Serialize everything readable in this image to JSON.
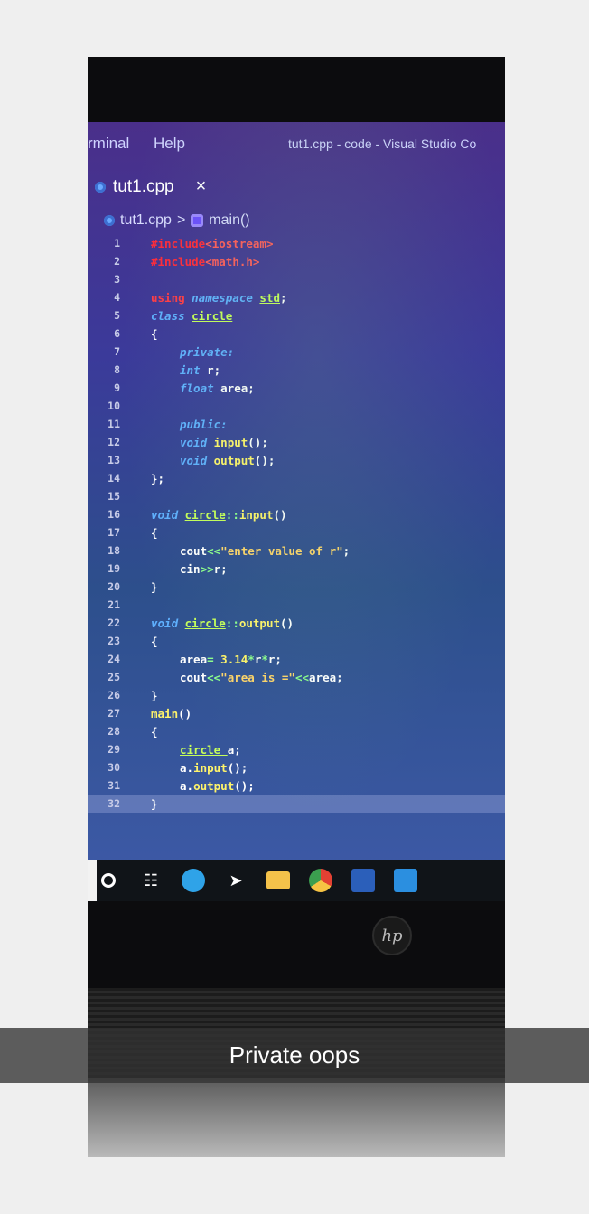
{
  "photo": {
    "menu": {
      "item_terminal": "rminal",
      "item_help": "Help",
      "window_title": "tut1.cpp - code - Visual Studio Co"
    },
    "tab": {
      "filename": "tut1.cpp",
      "close_glyph": "×"
    },
    "breadcrumb": {
      "file": "tut1.cpp",
      "separator": ">",
      "symbol": "main()"
    },
    "code_lines": [
      {
        "n": "1",
        "indent": 0,
        "parts": [
          {
            "t": "#include",
            "c": "inc"
          },
          {
            "t": "<iostream>",
            "c": "incf"
          }
        ]
      },
      {
        "n": "2",
        "indent": 0,
        "parts": [
          {
            "t": "#include",
            "c": "inc"
          },
          {
            "t": "<math.h>",
            "c": "incf"
          }
        ]
      },
      {
        "n": "3",
        "indent": 0,
        "parts": []
      },
      {
        "n": "4",
        "indent": 0,
        "parts": [
          {
            "t": "using ",
            "c": "kw"
          },
          {
            "t": "namespace ",
            "c": "ty"
          },
          {
            "t": "std",
            "c": "cls"
          },
          {
            "t": ";",
            "c": ""
          }
        ]
      },
      {
        "n": "5",
        "indent": 0,
        "parts": [
          {
            "t": "class ",
            "c": "ty"
          },
          {
            "t": "circle",
            "c": "cls"
          }
        ]
      },
      {
        "n": "6",
        "indent": 0,
        "parts": [
          {
            "t": "{",
            "c": ""
          }
        ]
      },
      {
        "n": "7",
        "indent": 1,
        "parts": [
          {
            "t": "private:",
            "c": "ty"
          }
        ]
      },
      {
        "n": "8",
        "indent": 1,
        "parts": [
          {
            "t": "int ",
            "c": "ty"
          },
          {
            "t": "r;",
            "c": ""
          }
        ]
      },
      {
        "n": "9",
        "indent": 1,
        "parts": [
          {
            "t": "float ",
            "c": "ty"
          },
          {
            "t": "area;",
            "c": ""
          }
        ]
      },
      {
        "n": "10",
        "indent": 0,
        "parts": []
      },
      {
        "n": "11",
        "indent": 1,
        "parts": [
          {
            "t": "public:",
            "c": "ty"
          }
        ]
      },
      {
        "n": "12",
        "indent": 1,
        "parts": [
          {
            "t": "void ",
            "c": "ty"
          },
          {
            "t": "input",
            "c": "fn"
          },
          {
            "t": "();",
            "c": ""
          }
        ]
      },
      {
        "n": "13",
        "indent": 1,
        "parts": [
          {
            "t": "void ",
            "c": "ty"
          },
          {
            "t": "output",
            "c": "fn"
          },
          {
            "t": "();",
            "c": ""
          }
        ]
      },
      {
        "n": "14",
        "indent": 0,
        "parts": [
          {
            "t": "};",
            "c": ""
          }
        ]
      },
      {
        "n": "15",
        "indent": 0,
        "parts": []
      },
      {
        "n": "16",
        "indent": 0,
        "parts": [
          {
            "t": "void ",
            "c": "ty"
          },
          {
            "t": "circle",
            "c": "cls"
          },
          {
            "t": "::",
            "c": "op"
          },
          {
            "t": "input",
            "c": "fn"
          },
          {
            "t": "()",
            "c": ""
          }
        ]
      },
      {
        "n": "17",
        "indent": 0,
        "parts": [
          {
            "t": "{",
            "c": ""
          }
        ]
      },
      {
        "n": "18",
        "indent": 1,
        "parts": [
          {
            "t": "cout",
            "c": ""
          },
          {
            "t": "<<",
            "c": "op"
          },
          {
            "t": "\"enter value of r\"",
            "c": "str"
          },
          {
            "t": ";",
            "c": ""
          }
        ]
      },
      {
        "n": "19",
        "indent": 1,
        "parts": [
          {
            "t": "cin",
            "c": ""
          },
          {
            "t": ">>",
            "c": "op"
          },
          {
            "t": "r;",
            "c": ""
          }
        ]
      },
      {
        "n": "20",
        "indent": 0,
        "parts": [
          {
            "t": "}",
            "c": ""
          }
        ]
      },
      {
        "n": "21",
        "indent": 0,
        "parts": []
      },
      {
        "n": "22",
        "indent": 0,
        "parts": [
          {
            "t": "void ",
            "c": "ty"
          },
          {
            "t": "circle",
            "c": "cls"
          },
          {
            "t": "::",
            "c": "op"
          },
          {
            "t": "output",
            "c": "fn"
          },
          {
            "t": "()",
            "c": ""
          }
        ]
      },
      {
        "n": "23",
        "indent": 0,
        "parts": [
          {
            "t": "{",
            "c": ""
          }
        ]
      },
      {
        "n": "24",
        "indent": 1,
        "parts": [
          {
            "t": "area",
            "c": ""
          },
          {
            "t": "= ",
            "c": "op"
          },
          {
            "t": "3.14",
            "c": "fn"
          },
          {
            "t": "*",
            "c": "op"
          },
          {
            "t": "r",
            "c": ""
          },
          {
            "t": "*",
            "c": "op"
          },
          {
            "t": "r;",
            "c": ""
          }
        ]
      },
      {
        "n": "25",
        "indent": 1,
        "parts": [
          {
            "t": "cout",
            "c": ""
          },
          {
            "t": "<<",
            "c": "op"
          },
          {
            "t": "\"area is =\"",
            "c": "str"
          },
          {
            "t": "<<",
            "c": "op"
          },
          {
            "t": "area;",
            "c": ""
          }
        ]
      },
      {
        "n": "26",
        "indent": 0,
        "parts": [
          {
            "t": "}",
            "c": ""
          }
        ]
      },
      {
        "n": "27",
        "indent": 0,
        "parts": [
          {
            "t": "main",
            "c": "fn"
          },
          {
            "t": "()",
            "c": ""
          }
        ]
      },
      {
        "n": "28",
        "indent": 0,
        "parts": [
          {
            "t": "{",
            "c": ""
          }
        ]
      },
      {
        "n": "29",
        "indent": 1,
        "parts": [
          {
            "t": "circle ",
            "c": "cls"
          },
          {
            "t": "a;",
            "c": ""
          }
        ]
      },
      {
        "n": "30",
        "indent": 1,
        "parts": [
          {
            "t": "a.",
            "c": ""
          },
          {
            "t": "input",
            "c": "fn"
          },
          {
            "t": "();",
            "c": ""
          }
        ]
      },
      {
        "n": "31",
        "indent": 1,
        "parts": [
          {
            "t": "a.",
            "c": ""
          },
          {
            "t": "output",
            "c": "fn"
          },
          {
            "t": "();",
            "c": ""
          }
        ]
      },
      {
        "n": "32",
        "indent": 0,
        "parts": [
          {
            "t": "}",
            "c": ""
          }
        ]
      }
    ],
    "taskbar_icons": [
      "search-circle-icon",
      "task-view-icon",
      "edge-icon",
      "app-icon",
      "file-explorer-icon",
      "chrome-icon",
      "word-icon",
      "vscode-icon"
    ],
    "laptop_brand": "hp"
  },
  "caption": "Private oops"
}
